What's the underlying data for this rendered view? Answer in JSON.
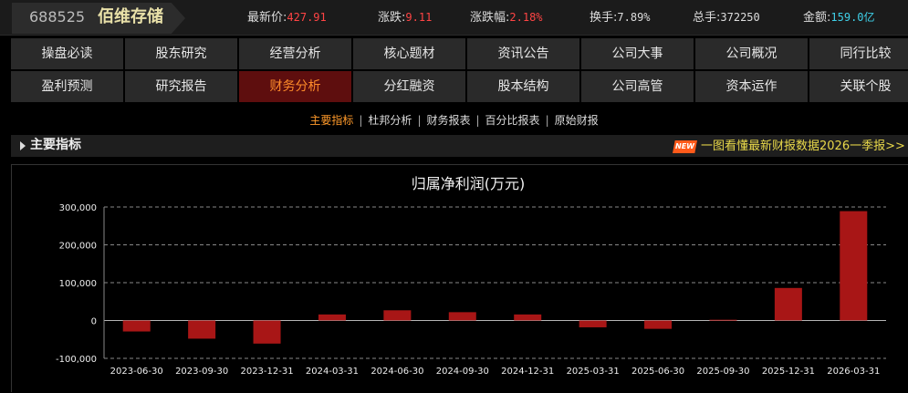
{
  "stock": {
    "code": "688525",
    "name": "佰维存储",
    "price_label": "最新价:",
    "price": "427.91",
    "change_label": "涨跌:",
    "change": "9.11",
    "change_pct_label": "涨跌幅:",
    "change_pct": "2.18%",
    "turnover_label": "换手:",
    "turnover": "7.89%",
    "volume_label": "总手:",
    "volume": "372250",
    "amount_label": "金额:",
    "amount": "159.0亿",
    "colors": {
      "up": "#ff4444",
      "amount": "#3fd0e8",
      "name": "#e8e0a8"
    }
  },
  "nav": {
    "row1": [
      "操盘必读",
      "股东研究",
      "经营分析",
      "核心题材",
      "资讯公告",
      "公司大事",
      "公司概况",
      "同行比较"
    ],
    "row2": [
      "盈利预测",
      "研究报告",
      "财务分析",
      "分红融资",
      "股本结构",
      "公司高管",
      "资本运作",
      "关联个股"
    ],
    "active": "财务分析"
  },
  "subtabs": {
    "items": [
      "主要指标",
      "杜邦分析",
      "财务报表",
      "百分比报表",
      "原始财报"
    ],
    "selected": "主要指标"
  },
  "section": {
    "title": "主要指标",
    "new_badge": "NEW",
    "promo_link": "一图看懂最新财报数据2026一季报>>"
  },
  "chart_data": {
    "type": "bar",
    "title": "归属净利润(万元)",
    "categories": [
      "2023-06-30",
      "2023-09-30",
      "2023-12-31",
      "2024-03-31",
      "2024-06-30",
      "2024-09-30",
      "2024-12-31",
      "2025-03-31",
      "2025-06-30",
      "2025-09-30",
      "2025-12-31",
      "2026-03-31"
    ],
    "values": [
      -29000,
      -48000,
      -61000,
      16000,
      27000,
      22000,
      16000,
      -18000,
      -22000,
      2000,
      86000,
      289000
    ],
    "yticks": [
      "300,000",
      "200,000",
      "100,000",
      "0",
      "-100,000"
    ],
    "ylim": [
      -100000,
      300000
    ],
    "grid": true,
    "bar_color": "#a81616"
  }
}
